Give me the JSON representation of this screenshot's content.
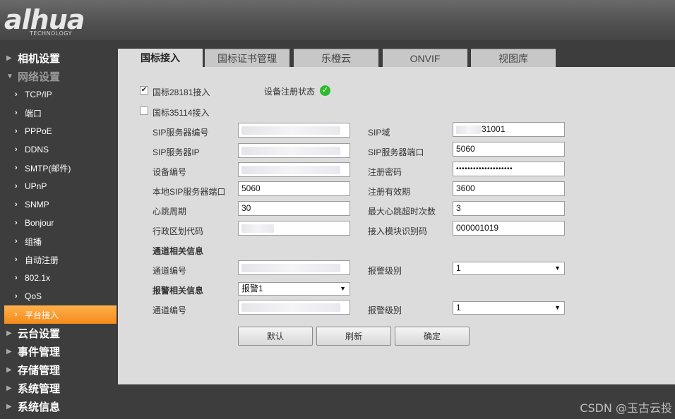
{
  "header": {
    "logo_text": "alhua",
    "logo_subtext": "TECHNOLOGY"
  },
  "sidebar": {
    "items": [
      {
        "label": "相机设置",
        "level": "top",
        "state": "collapsed"
      },
      {
        "label": "网络设置",
        "level": "top",
        "state": "expanded"
      },
      {
        "label": "TCP/IP",
        "level": "sub"
      },
      {
        "label": "端口",
        "level": "sub"
      },
      {
        "label": "PPPoE",
        "level": "sub"
      },
      {
        "label": "DDNS",
        "level": "sub"
      },
      {
        "label": "SMTP(邮件)",
        "level": "sub"
      },
      {
        "label": "UPnP",
        "level": "sub"
      },
      {
        "label": "SNMP",
        "level": "sub"
      },
      {
        "label": "Bonjour",
        "level": "sub"
      },
      {
        "label": "组播",
        "level": "sub"
      },
      {
        "label": "自动注册",
        "level": "sub"
      },
      {
        "label": "802.1x",
        "level": "sub"
      },
      {
        "label": "QoS",
        "level": "sub"
      },
      {
        "label": "平台接入",
        "level": "sub",
        "state": "active"
      },
      {
        "label": "云台设置",
        "level": "top",
        "state": "collapsed"
      },
      {
        "label": "事件管理",
        "level": "top",
        "state": "collapsed"
      },
      {
        "label": "存储管理",
        "level": "top",
        "state": "collapsed"
      },
      {
        "label": "系统管理",
        "level": "top",
        "state": "collapsed"
      },
      {
        "label": "系统信息",
        "level": "top",
        "state": "collapsed"
      }
    ]
  },
  "tabs": [
    {
      "label": "国标接入",
      "active": true
    },
    {
      "label": "国标证书管理",
      "active": false
    },
    {
      "label": "乐橙云",
      "active": false
    },
    {
      "label": "ONVIF",
      "active": false
    },
    {
      "label": "视图库",
      "active": false
    }
  ],
  "form": {
    "gb28181": {
      "label": "国标28181接入",
      "checked": true
    },
    "reg_status": {
      "label": "设备注册状态",
      "icon": "check-circle-icon",
      "color": "#2dbb2d"
    },
    "gb35114": {
      "label": "国标35114接入",
      "checked": false
    },
    "sip_server_id": {
      "label": "SIP服务器编号",
      "value": ""
    },
    "sip_domain": {
      "label": "SIP域",
      "value": "31001"
    },
    "sip_server_ip": {
      "label": "SIP服务器IP",
      "value": ""
    },
    "sip_server_port": {
      "label": "SIP服务器端口",
      "value": "5060"
    },
    "device_id": {
      "label": "设备编号",
      "value": ""
    },
    "reg_password": {
      "label": "注册密码",
      "value": "••••••••••••••••••••"
    },
    "local_sip_port": {
      "label": "本地SIP服务器端口",
      "value": "5060"
    },
    "reg_validity": {
      "label": "注册有效期",
      "value": "3600"
    },
    "heartbeat": {
      "label": "心跳周期",
      "value": "30"
    },
    "max_heartbeat_timeout": {
      "label": "最大心跳超时次数",
      "value": "3"
    },
    "region_code": {
      "label": "行政区划代码",
      "value": ""
    },
    "access_module_id": {
      "label": "接入模块识别码",
      "value": "000001019"
    },
    "channel_section": {
      "label": "通道相关信息"
    },
    "channel_no": {
      "label": "通道编号",
      "value": ""
    },
    "channel_alarm_level": {
      "label": "报警级别",
      "value": "1"
    },
    "alarm_section": {
      "label": "报警相关信息",
      "value": "报警1"
    },
    "alarm_channel_no": {
      "label": "通道编号",
      "value": ""
    },
    "alarm_level": {
      "label": "报警级别",
      "value": "1"
    }
  },
  "buttons": {
    "default": "默认",
    "refresh": "刷新",
    "ok": "确定"
  },
  "watermark": "CSDN @玉古云投"
}
